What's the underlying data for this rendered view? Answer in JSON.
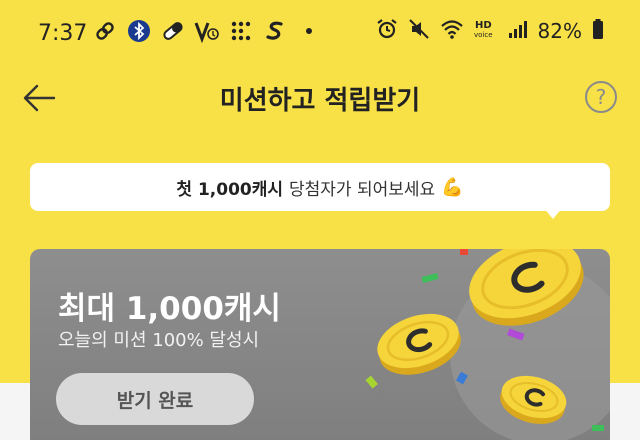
{
  "status_bar": {
    "time": "7:37",
    "battery": "82%",
    "left_icons": [
      "link-icon",
      "bluetooth-icon",
      "pill-icon",
      "v-check-icon",
      "dots-88-icon",
      "s-icon",
      "dot-icon"
    ],
    "right_icons": [
      "alarm-icon",
      "mute-icon",
      "wifi-icon",
      "hd-voice-icon",
      "signal-icon",
      "battery-icon"
    ]
  },
  "header": {
    "title": "미션하고 적립받기",
    "back_icon": "arrow-left-icon",
    "help_icon": "question-circle-icon"
  },
  "banner": {
    "strong_text": "첫 1,000캐시",
    "text": "당첨자가 되어보세요",
    "emoji": "💪"
  },
  "reward_card": {
    "title": "최대 1,000캐시",
    "subtitle": "오늘의 미션 100% 달성시",
    "button_label": "받기 완료"
  },
  "colors": {
    "background": "#F8E047",
    "card": "#8a8a8a",
    "coin": "#F5D53A"
  }
}
